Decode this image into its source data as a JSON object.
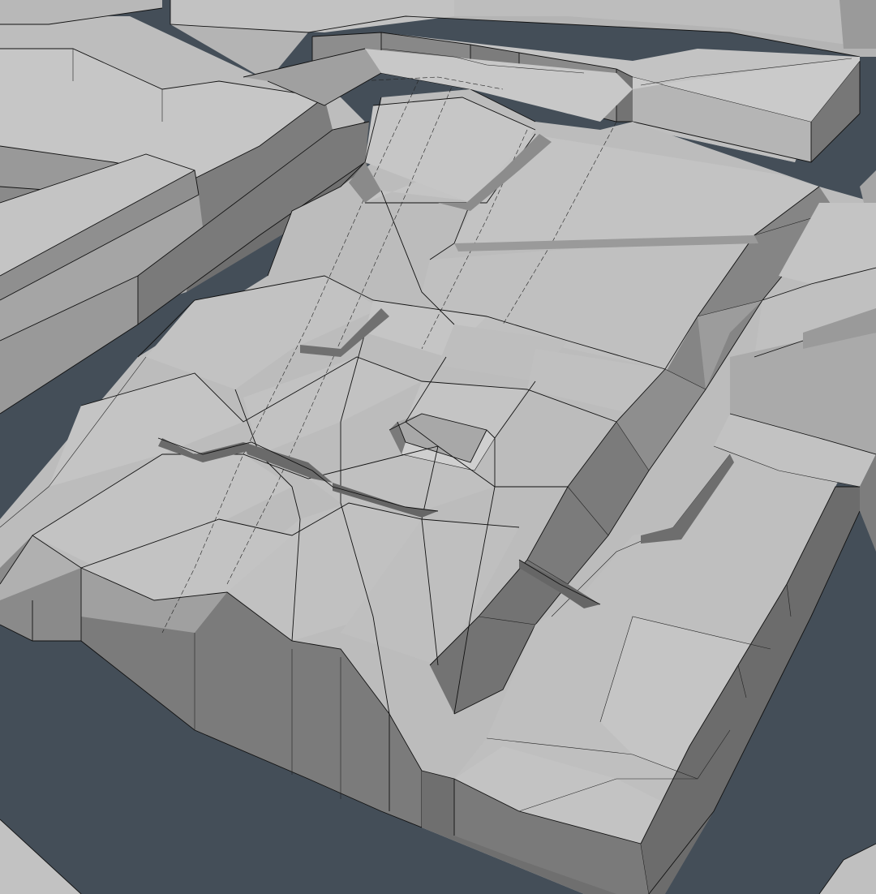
{
  "scene": {
    "description_icon": "3d-viewport-icon",
    "colors": {
      "background": "#444e58",
      "top_face": "#bcbcbc",
      "top_face_light": "#c6c6c6",
      "side_face": "#8c8c8c",
      "side_face_dark": "#6e6e6e",
      "bevel_face": "#a6a6a6",
      "edge_line": "#111111"
    }
  }
}
